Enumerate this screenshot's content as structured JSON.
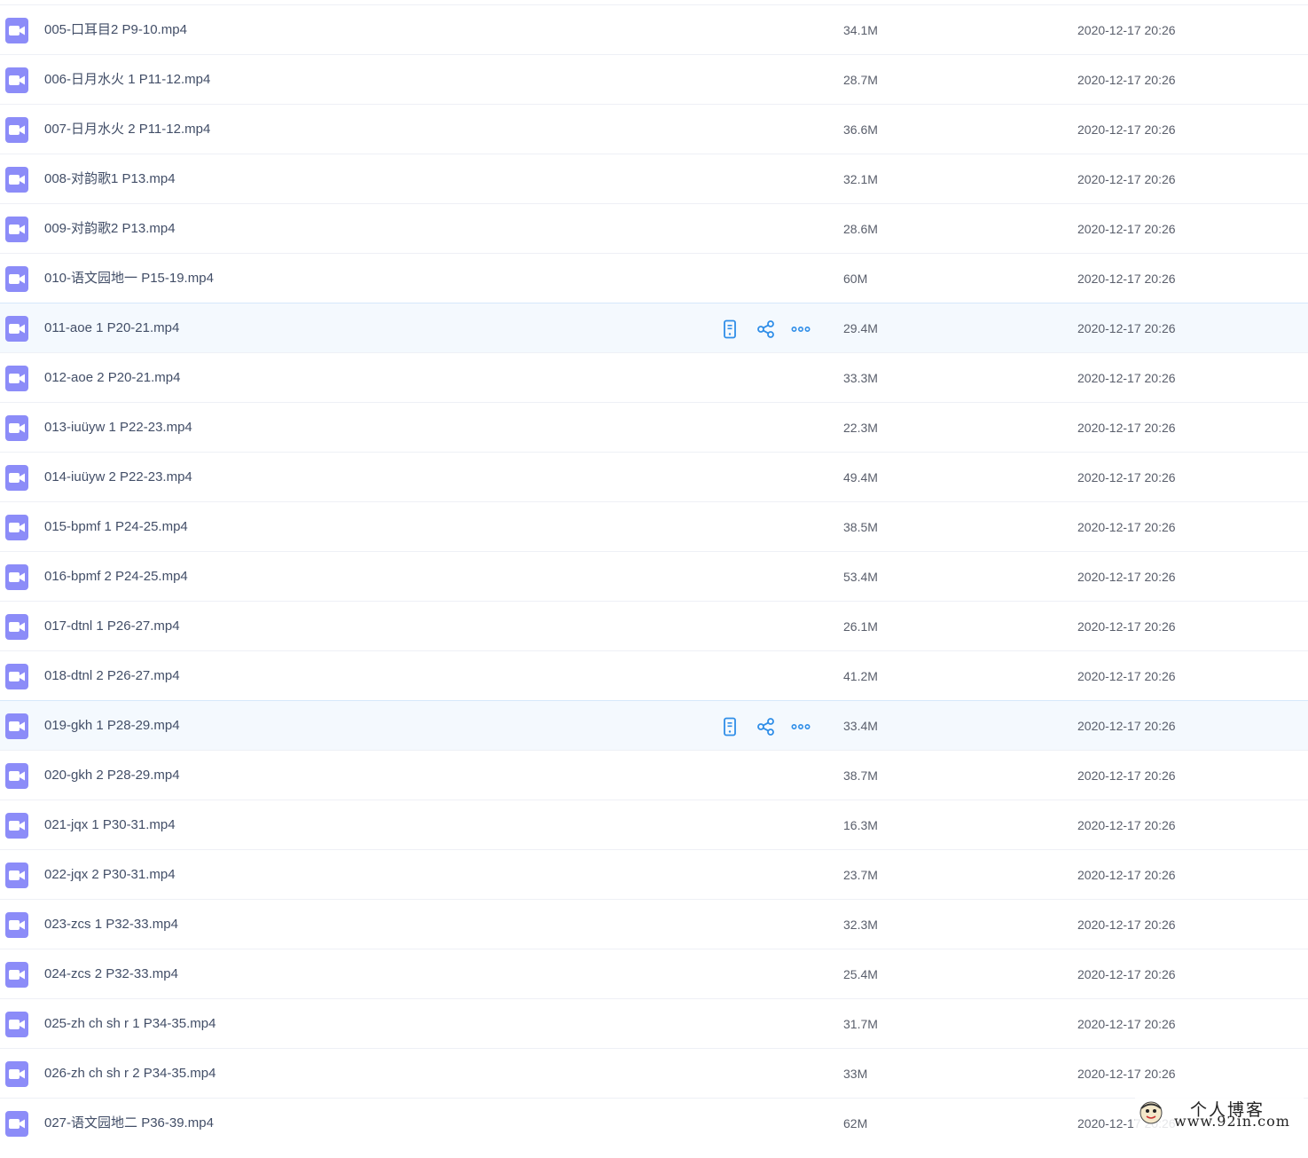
{
  "accent_color": "#2f8ee8",
  "file_icon_color": "#8c8cf8",
  "files": [
    {
      "name": "005-口耳目2 P9-10.mp4",
      "size": "34.1M",
      "date": "2020-12-17 20:26",
      "hover": false
    },
    {
      "name": "006-日月水火 1 P11-12.mp4",
      "size": "28.7M",
      "date": "2020-12-17 20:26",
      "hover": false
    },
    {
      "name": "007-日月水火 2 P11-12.mp4",
      "size": "36.6M",
      "date": "2020-12-17 20:26",
      "hover": false
    },
    {
      "name": "008-对韵歌1 P13.mp4",
      "size": "32.1M",
      "date": "2020-12-17 20:26",
      "hover": false
    },
    {
      "name": "009-对韵歌2 P13.mp4",
      "size": "28.6M",
      "date": "2020-12-17 20:26",
      "hover": false
    },
    {
      "name": "010-语文园地一 P15-19.mp4",
      "size": "60M",
      "date": "2020-12-17 20:26",
      "hover": false
    },
    {
      "name": "011-aoe 1 P20-21.mp4",
      "size": "29.4M",
      "date": "2020-12-17 20:26",
      "hover": true
    },
    {
      "name": "012-aoe 2 P20-21.mp4",
      "size": "33.3M",
      "date": "2020-12-17 20:26",
      "hover": false
    },
    {
      "name": "013-iuüyw 1 P22-23.mp4",
      "size": "22.3M",
      "date": "2020-12-17 20:26",
      "hover": false
    },
    {
      "name": "014-iuüyw 2 P22-23.mp4",
      "size": "49.4M",
      "date": "2020-12-17 20:26",
      "hover": false
    },
    {
      "name": "015-bpmf 1 P24-25.mp4",
      "size": "38.5M",
      "date": "2020-12-17 20:26",
      "hover": false
    },
    {
      "name": "016-bpmf 2 P24-25.mp4",
      "size": "53.4M",
      "date": "2020-12-17 20:26",
      "hover": false
    },
    {
      "name": "017-dtnl 1 P26-27.mp4",
      "size": "26.1M",
      "date": "2020-12-17 20:26",
      "hover": false
    },
    {
      "name": "018-dtnl 2 P26-27.mp4",
      "size": "41.2M",
      "date": "2020-12-17 20:26",
      "hover": false
    },
    {
      "name": "019-gkh 1 P28-29.mp4",
      "size": "33.4M",
      "date": "2020-12-17 20:26",
      "hover": true
    },
    {
      "name": "020-gkh 2 P28-29.mp4",
      "size": "38.7M",
      "date": "2020-12-17 20:26",
      "hover": false
    },
    {
      "name": "021-jqx 1 P30-31.mp4",
      "size": "16.3M",
      "date": "2020-12-17 20:26",
      "hover": false
    },
    {
      "name": "022-jqx 2 P30-31.mp4",
      "size": "23.7M",
      "date": "2020-12-17 20:26",
      "hover": false
    },
    {
      "name": "023-zcs 1 P32-33.mp4",
      "size": "32.3M",
      "date": "2020-12-17 20:26",
      "hover": false
    },
    {
      "name": "024-zcs 2 P32-33.mp4",
      "size": "25.4M",
      "date": "2020-12-17 20:26",
      "hover": false
    },
    {
      "name": "025-zh ch sh r 1 P34-35.mp4",
      "size": "31.7M",
      "date": "2020-12-17 20:26",
      "hover": false
    },
    {
      "name": "026-zh ch sh r 2 P34-35.mp4",
      "size": "33M",
      "date": "2020-12-17 20:26",
      "hover": false
    },
    {
      "name": "027-语文园地二 P36-39.mp4",
      "size": "62M",
      "date": "2020-12-17 20:26",
      "hover": false
    }
  ],
  "watermark": {
    "line1": "个人博客",
    "line2": "www.92in.com"
  }
}
